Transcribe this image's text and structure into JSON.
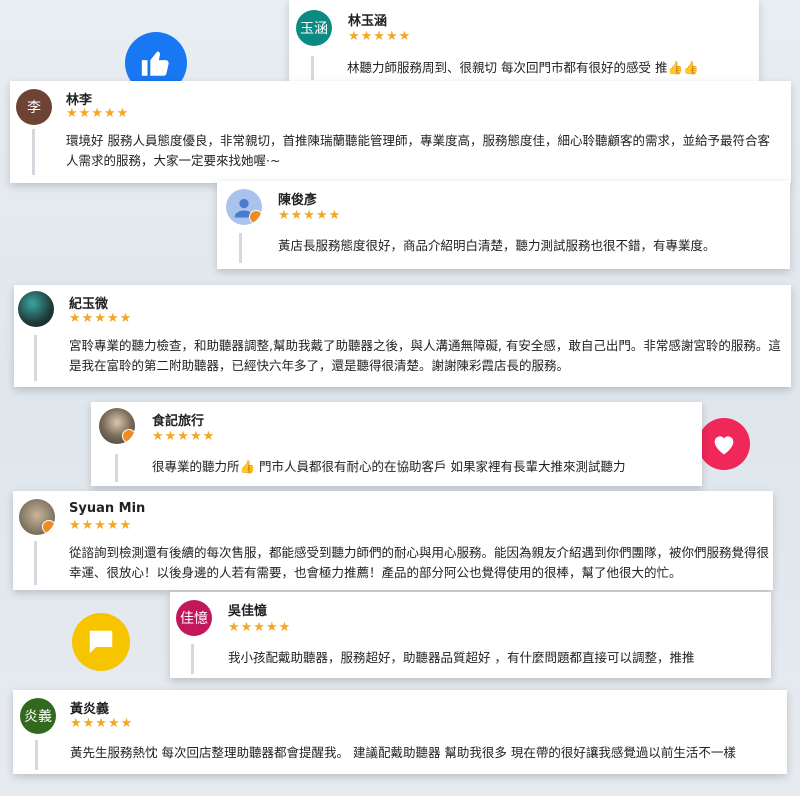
{
  "reviews": [
    {
      "initials": "玉涵",
      "name": "林玉涵",
      "stars": "★★★★★",
      "text": "林聽力師服務周到、很親切 每次回門市都有很好的感受 推👍👍",
      "avatar_color": "#0b8a83"
    },
    {
      "initials": "李",
      "name": "林李",
      "stars": "★★★★★",
      "text": "環境好 服務人員態度優良，非常親切，首推陳瑞蘭聽能管理師，專業度高，服務態度佳，細心聆聽顧客的需求，並給予最符合客人需求的服務，大家一定要來找她喔·~",
      "avatar_color": "#6d4434"
    },
    {
      "initials": "",
      "name": "陳俊彥",
      "stars": "★★★★★",
      "text": "黃店長服務態度很好，商品介紹明白清楚，聽力測試服務也很不錯，有專業度。",
      "avatar_color": "#aac3ec"
    },
    {
      "initials": "",
      "name": "紀玉微",
      "stars": "★★★★★",
      "text": "宮聆專業的聽力檢查，和助聽器調整,幫助我戴了助聽器之後，與人溝通無障礙, 有安全感，敢自己出門。非常感謝宮聆的服務。這是我在富聆的第二附助聽器，已經快六年多了，還是聽得很清楚。謝謝陳彩霞店長的服務。",
      "avatar_color": "#1f3a3a"
    },
    {
      "initials": "",
      "name": "食記旅行",
      "stars": "★★★★★",
      "text": "很專業的聽力所👍 門市人員都很有耐心的在協助客戶 如果家裡有長輩大推來測試聽力",
      "avatar_color": "#5a5a5a"
    },
    {
      "initials": "",
      "name": "Syuan Min",
      "stars": "★★★★★",
      "text": "從諮詢到檢測還有後續的每次售服，都能感受到聽力師們的耐心與用心服務。能因為親友介紹遇到你們團隊，被你們服務覺得很幸運、很放心！以後身邊的人若有需要，也會極力推薦！產品的部分阿公也覺得使用的很棒，幫了他很大的忙。",
      "avatar_color": "#8a7f6b"
    },
    {
      "initials": "佳憶",
      "name": "吳佳憶",
      "stars": "★★★★★",
      "text": "我小孩配戴助聽器，服務超好，助聽器品質超好 ，有什麼問題都直接可以調整，推推",
      "avatar_color": "#c2185b"
    },
    {
      "initials": "炎義",
      "name": "黃炎義",
      "stars": "★★★★★",
      "text": "黃先生服務熱忱 每次回店整理助聽器都會提醒我。 建議配戴助聽器 幫助我很多 現在帶的很好讓我感覺過以前生活不一樣",
      "avatar_color": "#33691e"
    }
  ],
  "decorations": {
    "thumb_color": "#1877f2",
    "heart_color": "#f0285a",
    "chat_color": "#f7c400"
  }
}
